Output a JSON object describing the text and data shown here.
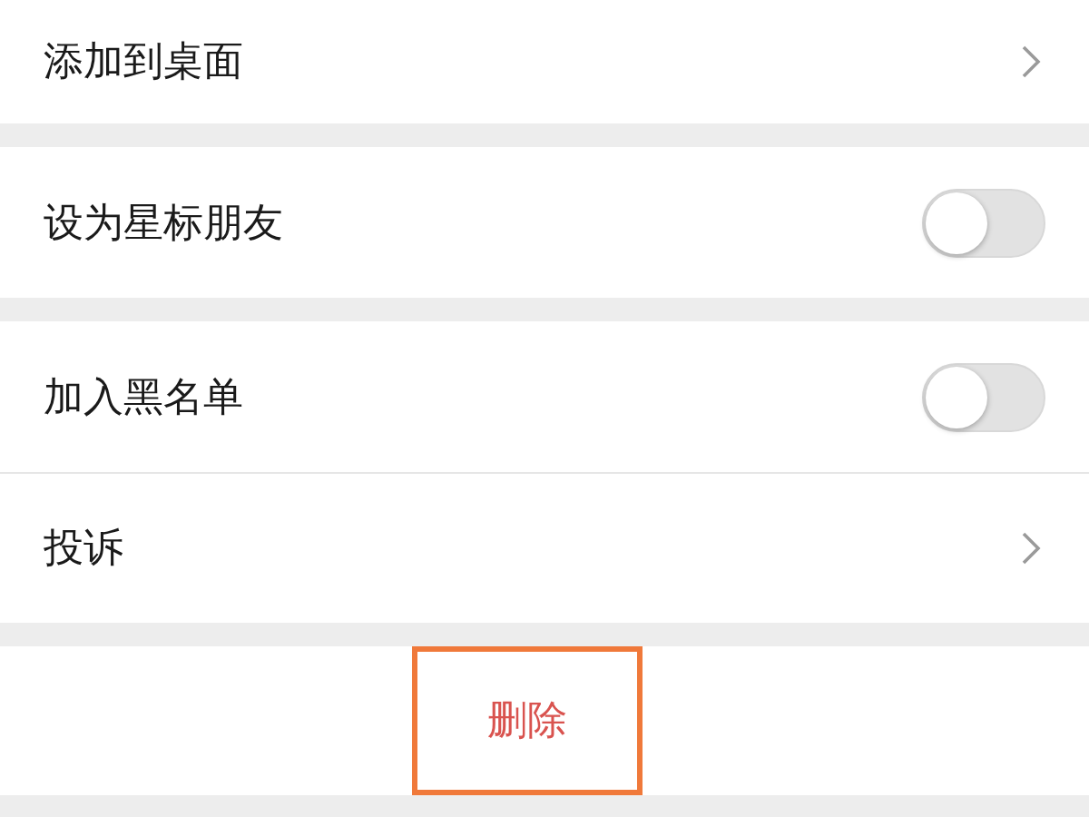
{
  "groups": [
    {
      "rows": [
        {
          "kind": "link",
          "label": "添加到桌面"
        }
      ]
    },
    {
      "rows": [
        {
          "kind": "toggle",
          "label": "设为星标朋友",
          "on": false
        }
      ]
    },
    {
      "rows": [
        {
          "kind": "toggle",
          "label": "加入黑名单",
          "on": false
        },
        {
          "kind": "link",
          "label": "投诉"
        }
      ]
    }
  ],
  "delete_button": {
    "label": "删除",
    "highlighted": true
  }
}
